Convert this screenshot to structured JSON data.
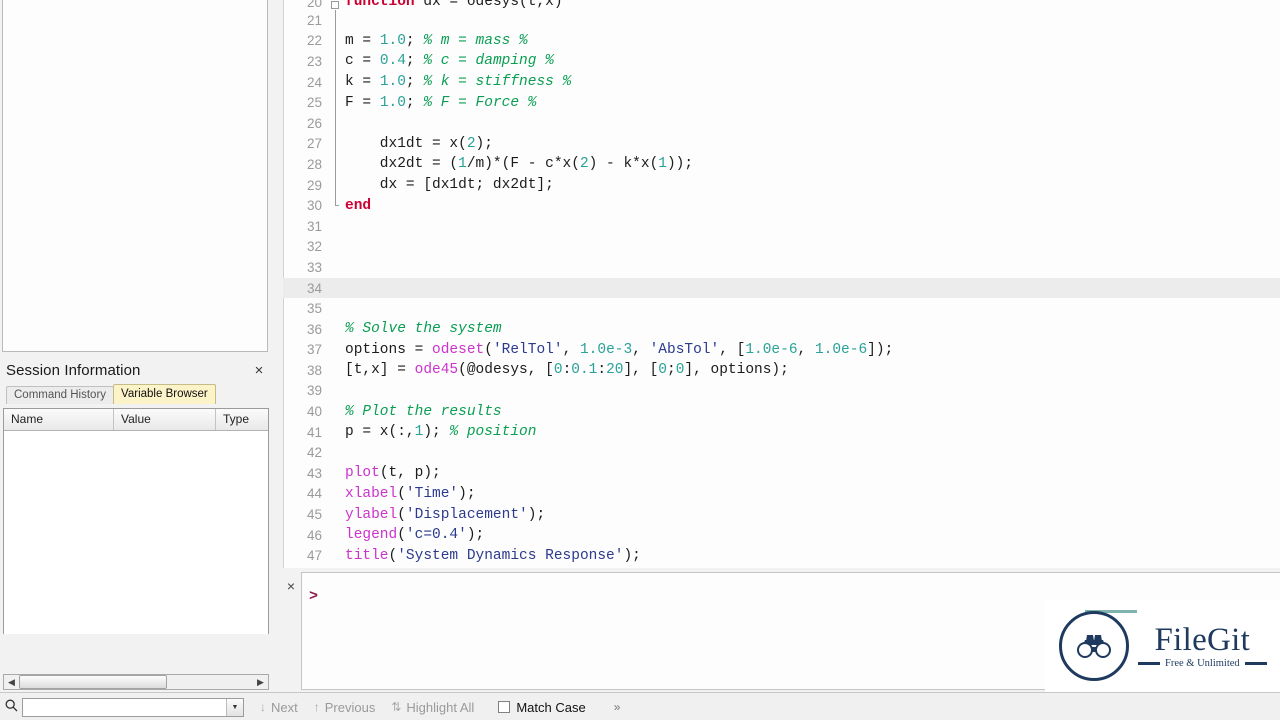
{
  "file_browser": {
    "empty": ""
  },
  "session": {
    "title": "Session Information",
    "close_label": "×",
    "tabs": [
      {
        "label": "Command History",
        "active": false
      },
      {
        "label": "Variable Browser",
        "active": true
      }
    ],
    "table": {
      "columns": [
        "Name",
        "Value",
        "Type"
      ],
      "rows": []
    },
    "scroll": {
      "left_arrow": "◀",
      "right_arrow": "▶"
    }
  },
  "editor": {
    "current_line": 34,
    "lines": [
      {
        "n": "20",
        "fold": "open",
        "clipped": true,
        "tokens": [
          {
            "t": "function",
            "c": "kw"
          },
          {
            "t": " dx = odesys(t,x)",
            "c": "pl"
          }
        ]
      },
      {
        "n": "21",
        "fold": "bar",
        "tokens": []
      },
      {
        "n": "22",
        "fold": "bar",
        "tokens": [
          {
            "t": "m = ",
            "c": "pl"
          },
          {
            "t": "1.0",
            "c": "num"
          },
          {
            "t": "; ",
            "c": "pl"
          },
          {
            "t": "% m = mass %",
            "c": "cmt"
          }
        ]
      },
      {
        "n": "23",
        "fold": "bar",
        "tokens": [
          {
            "t": "c = ",
            "c": "pl"
          },
          {
            "t": "0.4",
            "c": "num"
          },
          {
            "t": "; ",
            "c": "pl"
          },
          {
            "t": "% c = damping %",
            "c": "cmt"
          }
        ]
      },
      {
        "n": "24",
        "fold": "bar",
        "tokens": [
          {
            "t": "k = ",
            "c": "pl"
          },
          {
            "t": "1.0",
            "c": "num"
          },
          {
            "t": "; ",
            "c": "pl"
          },
          {
            "t": "% k = stiffness %",
            "c": "cmt"
          }
        ]
      },
      {
        "n": "25",
        "fold": "bar",
        "tokens": [
          {
            "t": "F = ",
            "c": "pl"
          },
          {
            "t": "1.0",
            "c": "num"
          },
          {
            "t": "; ",
            "c": "pl"
          },
          {
            "t": "% F = Force %",
            "c": "cmt"
          }
        ]
      },
      {
        "n": "26",
        "fold": "bar",
        "tokens": []
      },
      {
        "n": "27",
        "fold": "bar",
        "tokens": [
          {
            "t": "    dx1dt = x(",
            "c": "pl"
          },
          {
            "t": "2",
            "c": "num"
          },
          {
            "t": ");",
            "c": "pl"
          }
        ]
      },
      {
        "n": "28",
        "fold": "bar",
        "tokens": [
          {
            "t": "    dx2dt = (",
            "c": "pl"
          },
          {
            "t": "1",
            "c": "num"
          },
          {
            "t": "/m)*(F - c*x(",
            "c": "pl"
          },
          {
            "t": "2",
            "c": "num"
          },
          {
            "t": ") - k*x(",
            "c": "pl"
          },
          {
            "t": "1",
            "c": "num"
          },
          {
            "t": "));",
            "c": "pl"
          }
        ]
      },
      {
        "n": "29",
        "fold": "bar",
        "tokens": [
          {
            "t": "    dx = [dx1dt; dx2dt];",
            "c": "pl"
          }
        ]
      },
      {
        "n": "30",
        "fold": "end",
        "tokens": [
          {
            "t": "end",
            "c": "kw"
          }
        ]
      },
      {
        "n": "31",
        "fold": "none",
        "tokens": []
      },
      {
        "n": "32",
        "fold": "none",
        "tokens": []
      },
      {
        "n": "33",
        "fold": "none",
        "tokens": []
      },
      {
        "n": "34",
        "fold": "none",
        "tokens": []
      },
      {
        "n": "35",
        "fold": "none",
        "tokens": []
      },
      {
        "n": "36",
        "fold": "none",
        "tokens": [
          {
            "t": "% Solve the system",
            "c": "cmt"
          }
        ]
      },
      {
        "n": "37",
        "fold": "none",
        "tokens": [
          {
            "t": "options = ",
            "c": "pl"
          },
          {
            "t": "odeset",
            "c": "fn"
          },
          {
            "t": "(",
            "c": "pl"
          },
          {
            "t": "'RelTol'",
            "c": "str"
          },
          {
            "t": ", ",
            "c": "pl"
          },
          {
            "t": "1.0e-3",
            "c": "num"
          },
          {
            "t": ", ",
            "c": "pl"
          },
          {
            "t": "'AbsTol'",
            "c": "str"
          },
          {
            "t": ", [",
            "c": "pl"
          },
          {
            "t": "1.0e-6",
            "c": "num"
          },
          {
            "t": ", ",
            "c": "pl"
          },
          {
            "t": "1.0e-6",
            "c": "num"
          },
          {
            "t": "]);",
            "c": "pl"
          }
        ]
      },
      {
        "n": "38",
        "fold": "none",
        "tokens": [
          {
            "t": "[t,x] = ",
            "c": "pl"
          },
          {
            "t": "ode45",
            "c": "fn"
          },
          {
            "t": "(@odesys, [",
            "c": "pl"
          },
          {
            "t": "0",
            "c": "num"
          },
          {
            "t": ":",
            "c": "pl"
          },
          {
            "t": "0.1",
            "c": "num"
          },
          {
            "t": ":",
            "c": "pl"
          },
          {
            "t": "20",
            "c": "num"
          },
          {
            "t": "], [",
            "c": "pl"
          },
          {
            "t": "0",
            "c": "num"
          },
          {
            "t": ";",
            "c": "pl"
          },
          {
            "t": "0",
            "c": "num"
          },
          {
            "t": "], options);",
            "c": "pl"
          }
        ]
      },
      {
        "n": "39",
        "fold": "none",
        "tokens": []
      },
      {
        "n": "40",
        "fold": "none",
        "tokens": [
          {
            "t": "% Plot the results",
            "c": "cmt"
          }
        ]
      },
      {
        "n": "41",
        "fold": "none",
        "tokens": [
          {
            "t": "p = x(:,",
            "c": "pl"
          },
          {
            "t": "1",
            "c": "num"
          },
          {
            "t": "); ",
            "c": "pl"
          },
          {
            "t": "% position",
            "c": "cmt"
          }
        ]
      },
      {
        "n": "42",
        "fold": "none",
        "tokens": []
      },
      {
        "n": "43",
        "fold": "none",
        "tokens": [
          {
            "t": "plot",
            "c": "fn"
          },
          {
            "t": "(t, p);",
            "c": "pl"
          }
        ]
      },
      {
        "n": "44",
        "fold": "none",
        "tokens": [
          {
            "t": "xlabel",
            "c": "fn"
          },
          {
            "t": "(",
            "c": "pl"
          },
          {
            "t": "'Time'",
            "c": "str"
          },
          {
            "t": ");",
            "c": "pl"
          }
        ]
      },
      {
        "n": "45",
        "fold": "none",
        "tokens": [
          {
            "t": "ylabel",
            "c": "fn"
          },
          {
            "t": "(",
            "c": "pl"
          },
          {
            "t": "'Displacement'",
            "c": "str"
          },
          {
            "t": ");",
            "c": "pl"
          }
        ]
      },
      {
        "n": "46",
        "fold": "none",
        "tokens": [
          {
            "t": "legend",
            "c": "fn"
          },
          {
            "t": "(",
            "c": "pl"
          },
          {
            "t": "'c=0.4'",
            "c": "str"
          },
          {
            "t": ");",
            "c": "pl"
          }
        ]
      },
      {
        "n": "47",
        "fold": "none",
        "tokens": [
          {
            "t": "title",
            "c": "fn"
          },
          {
            "t": "(",
            "c": "pl"
          },
          {
            "t": "'System Dynamics Response'",
            "c": "str"
          },
          {
            "t": ");",
            "c": "pl"
          }
        ]
      }
    ]
  },
  "command_window": {
    "close_label": "×",
    "prompt": ">",
    "input_value": ""
  },
  "find_bar": {
    "search_value": "",
    "search_placeholder": "",
    "combo_arrow": "▼",
    "buttons": [
      {
        "label": "Next",
        "glyph": "↓",
        "enabled": false
      },
      {
        "label": "Previous",
        "glyph": "↑",
        "enabled": false
      },
      {
        "label": "Highlight All",
        "glyph": "⇅",
        "enabled": false
      }
    ],
    "match_case": {
      "label": "Match Case",
      "checked": false
    },
    "more_glyph": "»"
  },
  "logo": {
    "name": "FileGit",
    "tagline": "Free & Unlimited",
    "accent_color": "#7fb3ad",
    "brand_color": "#1f3a5f"
  }
}
